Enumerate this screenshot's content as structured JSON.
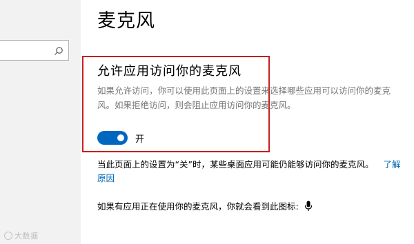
{
  "header": {
    "title": "麦克风"
  },
  "sidebar": {
    "watermark": "大数据"
  },
  "permission": {
    "heading": "允许应用访问你的麦克风",
    "description": "如果允许访问，你可以使用此页面上的设置来选择哪些应用可以访问你的麦克风。如果拒绝访问，则会阻止应用访问你的麦克风。",
    "toggle": {
      "state": "on",
      "label": "开"
    }
  },
  "note": {
    "text": "当此页面上的设置为“关”时，某些桌面应用可能仍能够访问你的麦克风。",
    "link": "了解原因"
  },
  "icon_notice": {
    "text": "如果有应用正在使用你的麦克风，你就会看到此图标:"
  },
  "colors": {
    "accent": "#0067c0",
    "highlight": "#c81e1e",
    "link": "#0066b4"
  },
  "icons": [
    "search-icon",
    "microphone-icon"
  ]
}
